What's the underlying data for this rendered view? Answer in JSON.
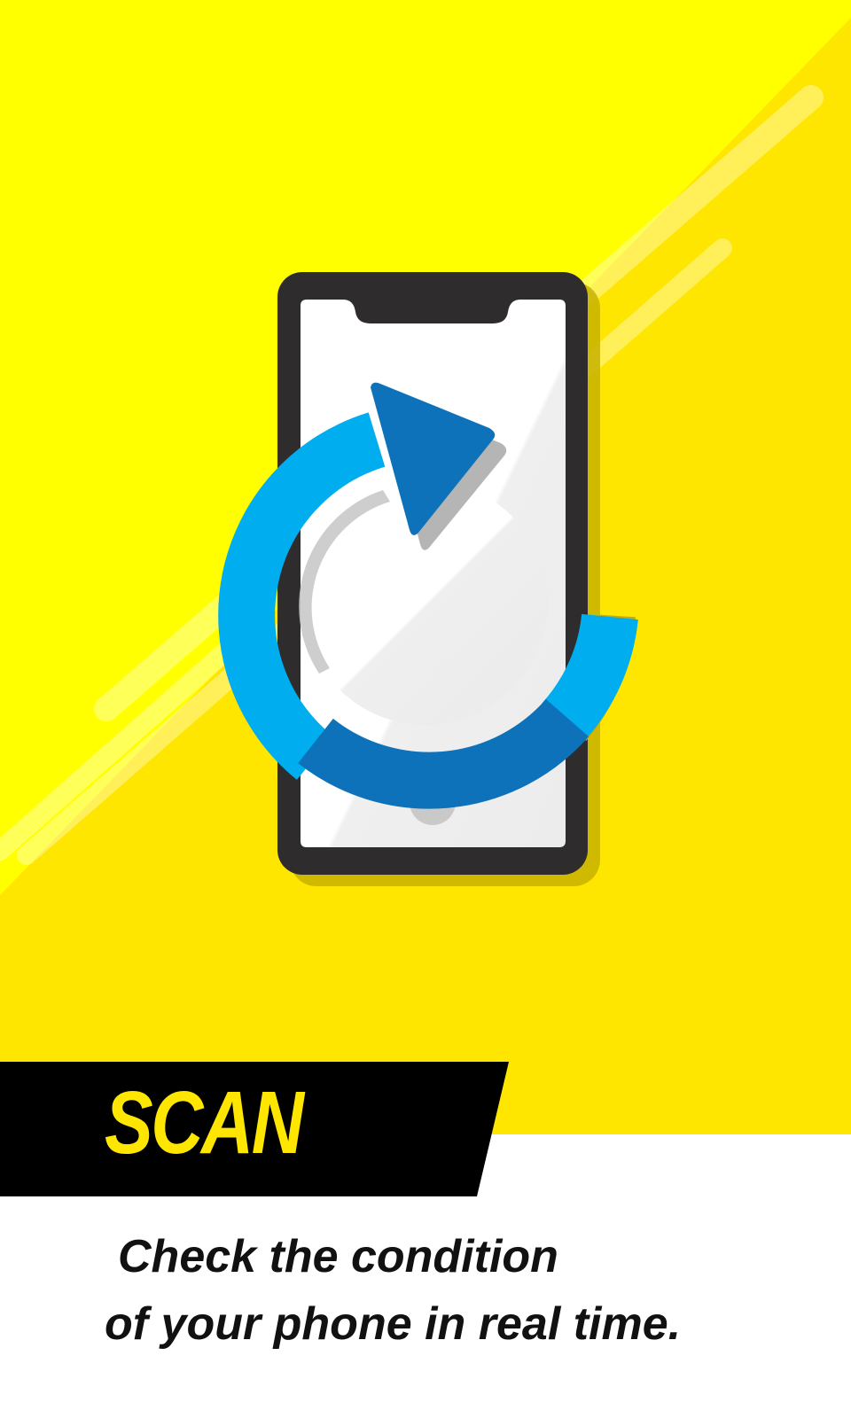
{
  "screen": {
    "title": "SCAN",
    "description_lines": [
      "Check the condition",
      "of your phone in real time."
    ]
  },
  "illustration": {
    "icon": "phone-refresh-icon",
    "colors": {
      "background_yellow": "#ffff00",
      "background_yellow_dark": "#ffe600",
      "phone_body": "#2f2c2d",
      "phone_screen": "#f2f2f2",
      "arrow_light_blue": "#00adef",
      "arrow_dark_blue": "#0d72ba",
      "banner_black": "#000000",
      "title_yellow": "#ffe600"
    }
  }
}
